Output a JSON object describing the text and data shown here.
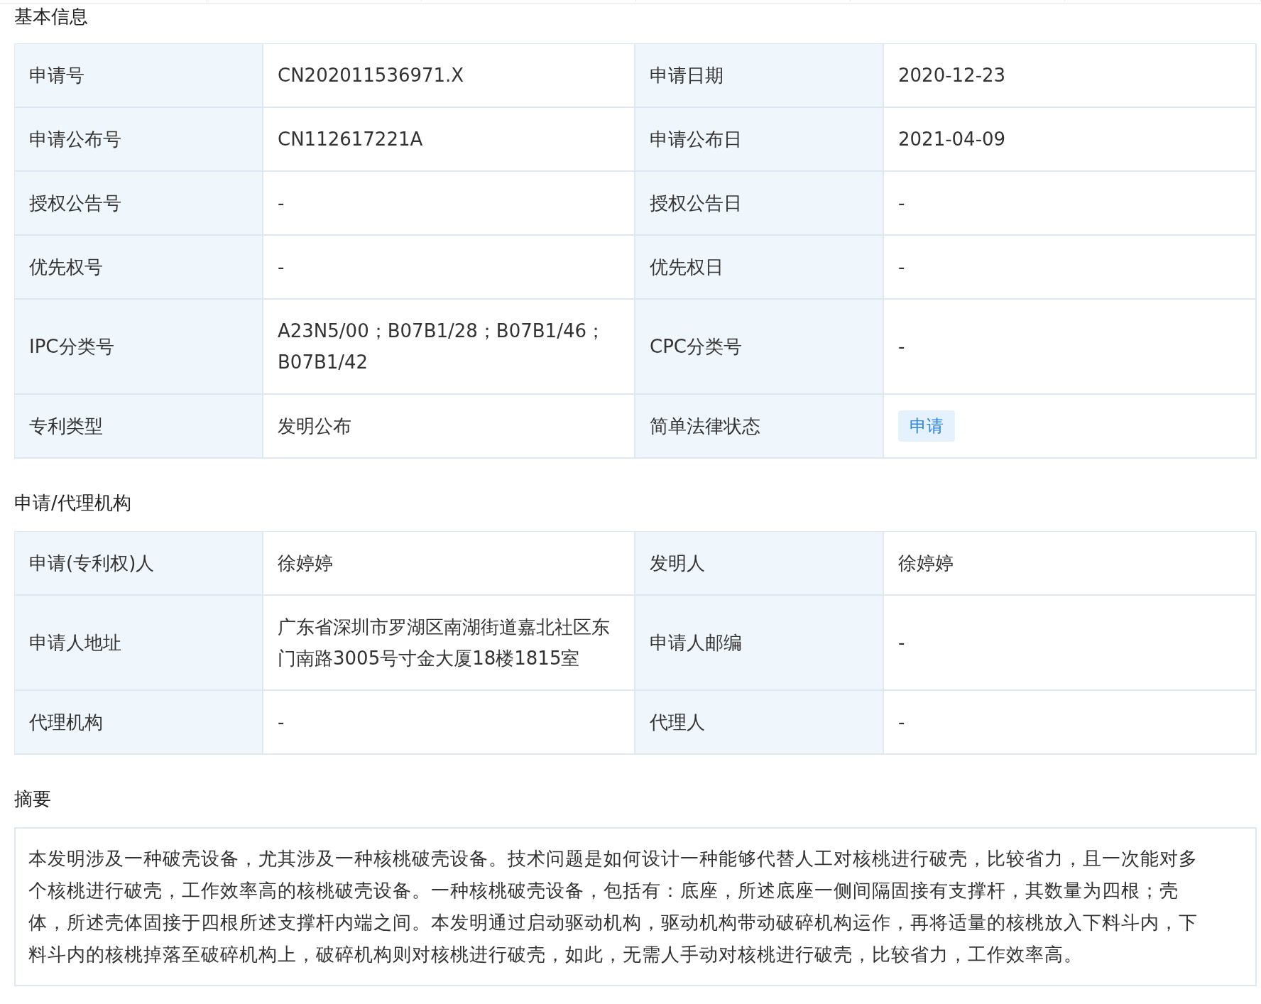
{
  "sections": [
    {
      "title": "基本信息",
      "kind": "table",
      "rows": [
        [
          {
            "label": "申请号",
            "value": "CN202011536971.X",
            "kind": "text"
          },
          {
            "label": "申请日期",
            "value": "2020-12-23",
            "kind": "text"
          }
        ],
        [
          {
            "label": "申请公布号",
            "value": "CN112617221A",
            "kind": "text"
          },
          {
            "label": "申请公布日",
            "value": "2021-04-09",
            "kind": "text"
          }
        ],
        [
          {
            "label": "授权公告号",
            "value": "-",
            "kind": "text"
          },
          {
            "label": "授权公告日",
            "value": "-",
            "kind": "text"
          }
        ],
        [
          {
            "label": "优先权号",
            "value": "-",
            "kind": "text"
          },
          {
            "label": "优先权日",
            "value": "-",
            "kind": "text"
          }
        ],
        [
          {
            "label": "IPC分类号",
            "value": "A23N5/00；B07B1/28；B07B1/46；B07B1/42",
            "kind": "text"
          },
          {
            "label": "CPC分类号",
            "value": "-",
            "kind": "text"
          }
        ],
        [
          {
            "label": "专利类型",
            "value": "发明公布",
            "kind": "text"
          },
          {
            "label": "简单法律状态",
            "value": "申请",
            "kind": "status"
          }
        ]
      ]
    },
    {
      "title": "申请/代理机构",
      "kind": "table",
      "rows": [
        [
          {
            "label": "申请(专利权)人",
            "value": "徐婷婷",
            "kind": "text"
          },
          {
            "label": "发明人",
            "value": "徐婷婷",
            "kind": "text"
          }
        ],
        [
          {
            "label": "申请人地址",
            "value": "广东省深圳市罗湖区南湖街道嘉北社区东门南路3005号寸金大厦18楼1815室",
            "kind": "text"
          },
          {
            "label": "申请人邮编",
            "value": "-",
            "kind": "text"
          }
        ],
        [
          {
            "label": "代理机构",
            "value": "-",
            "kind": "text"
          },
          {
            "label": "代理人",
            "value": "-",
            "kind": "text"
          }
        ]
      ]
    },
    {
      "title": "摘要",
      "kind": "text",
      "text": "本发明涉及一种破壳设备，尤其涉及一种核桃破壳设备。技术问题是如何设计一种能够代替人工对核桃进行破壳，比较省力，且一次能对多个核桃进行破壳，工作效率高的核桃破壳设备。一种核桃破壳设备，包括有：底座，所述底座一侧间隔固接有支撑杆，其数量为四根；壳体，所述壳体固接于四根所述支撑杆内端之间。本发明通过启动驱动机构，驱动机构带动破碎机构运作，再将适量的核桃放入下料斗内，下料斗内的核桃掉落至破碎机构上，破碎机构则对核桃进行破壳，如此，无需人手动对核桃进行破壳，比较省力，工作效率高。"
    }
  ]
}
